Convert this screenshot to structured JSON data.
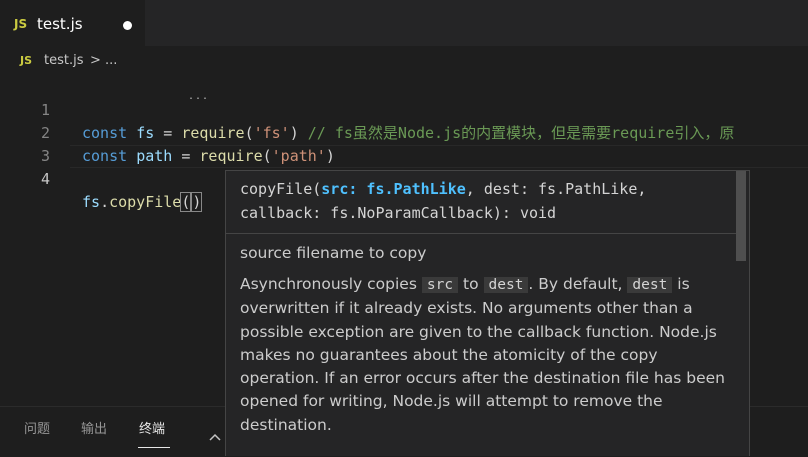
{
  "tab": {
    "badge": "JS",
    "title": "test.js"
  },
  "breadcrumb": {
    "badge": "JS",
    "file": "test.js",
    "separator": ">",
    "more": "..."
  },
  "editor": {
    "lines": [
      {
        "number": "1"
      },
      {
        "number": "2"
      },
      {
        "number": "3"
      },
      {
        "number": "4"
      }
    ],
    "line1": {
      "kw": "const",
      "var": "fs",
      "eq": "=",
      "fn": "require",
      "open": "(",
      "str": "'fs'",
      "close": ")",
      "comment": "// fs虽然是Node.js的内置模块，但是需要require引入，原"
    },
    "line2": {
      "kw": "const",
      "var": "path",
      "eq": "=",
      "fn": "require",
      "open": "(",
      "str": "'path'",
      "close": ")"
    },
    "line4": {
      "obj": "fs",
      "dot": ".",
      "fn": "copyFile",
      "open": "(",
      "close": ")"
    },
    "dots": "..."
  },
  "hover": {
    "signature": {
      "fn": "copyFile(",
      "active_param": "src: fs.PathLike",
      "rest1": ", dest: fs.PathLike,",
      "rest2": "callback: fs.NoParamCallback): void"
    },
    "param_doc": "source filename to copy",
    "desc": {
      "p1": "Asynchronously copies",
      "code1": "src",
      "p2": "to",
      "code2": "dest",
      "p3": ". By default,",
      "code3": "dest",
      "p4": "is overwritten if it already exists. No arguments other than a possible exception are given to the callback function. Node.js makes no guarantees about the atomicity of the copy operation. If an error occurs after the destination file has been opened for writing, Node.js will attempt to remove the destination."
    }
  },
  "panel": {
    "tabs": [
      {
        "label": "问题"
      },
      {
        "label": "输出"
      },
      {
        "label": "终端"
      }
    ]
  },
  "colors": {
    "background": "#1e1e1e",
    "hover_bg": "#252526",
    "keyword": "#569cd6",
    "string": "#ce9178",
    "comment": "#6a9955",
    "function": "#dcdcaa"
  }
}
